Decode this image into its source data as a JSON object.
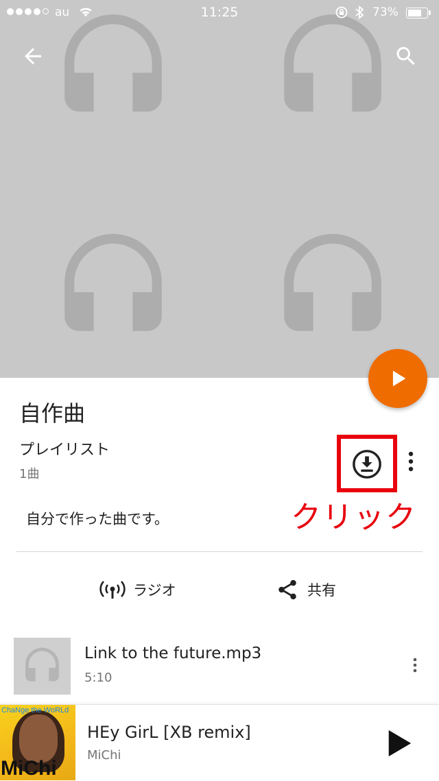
{
  "status_bar": {
    "carrier": "au",
    "time": "11:25",
    "battery": "73%",
    "battery_level": 0.73
  },
  "header": {
    "back_icon": "arrow-back-icon",
    "search_icon": "search-icon",
    "cover_icon": "headphones-icon"
  },
  "playlist": {
    "title": "自作曲",
    "type": "プレイリスト",
    "count": "1曲",
    "description": "自分で作った曲です。",
    "annotation": "クリック",
    "download_icon": "download-icon",
    "more_icon": "more-vert-icon"
  },
  "actions": {
    "radio_label": "ラジオ",
    "share_label": "共有"
  },
  "songs": [
    {
      "title": "Link to the future.mp3",
      "duration": "5:10"
    }
  ],
  "now_playing": {
    "title": "HEy GirL [XB remix]",
    "artist": "MiChi",
    "art_text_top": "ChaNge the WoRLd",
    "art_text_name": "MiChi"
  },
  "colors": {
    "accent": "#ef6c00",
    "annotation": "#e8000d",
    "hero_bg": "#c8c8c8"
  }
}
